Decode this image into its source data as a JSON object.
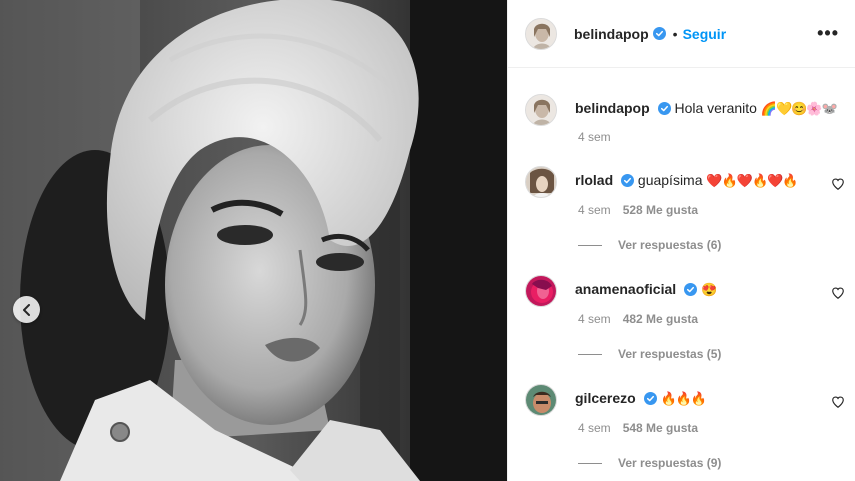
{
  "post": {
    "author": "belindapop",
    "follow_label": "Seguir",
    "separator": "•",
    "more_label": "•••"
  },
  "caption": {
    "username": "belindapop",
    "text": "Hola veranito",
    "emojis": "🌈💛😊🌸🐭",
    "time": "4 sem"
  },
  "comments": [
    {
      "username": "rlolad",
      "text": "guapísima",
      "emojis": "❤️🔥❤️🔥❤️🔥",
      "time": "4 sem",
      "likes": "528 Me gusta",
      "replies": "Ver respuestas (6)"
    },
    {
      "username": "anamenaoficial",
      "text": "",
      "emojis": "😍",
      "time": "4 sem",
      "likes": "482 Me gusta",
      "replies": "Ver respuestas (5)"
    },
    {
      "username": "gilcerezo",
      "text": "",
      "emojis": "🔥🔥🔥",
      "time": "4 sem",
      "likes": "548 Me gusta",
      "replies": "Ver respuestas (9)"
    }
  ],
  "colors": {
    "accent": "#0095f6",
    "muted": "#8e8e8e",
    "verified": "#3897f0"
  },
  "icons": {
    "verified": "verified-badge-icon",
    "heart": "heart-outline-icon",
    "prev": "chevron-left-icon"
  }
}
